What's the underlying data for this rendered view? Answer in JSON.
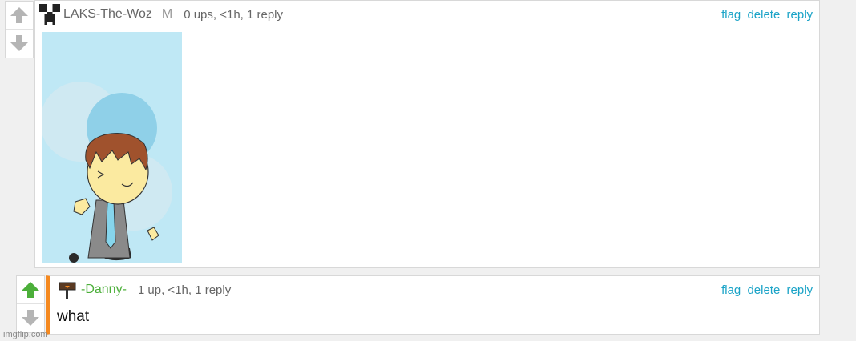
{
  "comments": [
    {
      "username": "LAKS-The-Woz",
      "badge": "M",
      "meta": "0 ups, <1h, 1 reply",
      "actions": {
        "flag": "flag",
        "delete": "delete",
        "reply": "reply"
      },
      "upvoted": false
    },
    {
      "username": "-Danny-",
      "meta": "1 up, <1h, 1 reply",
      "text": "what",
      "actions": {
        "flag": "flag",
        "delete": "delete",
        "reply": "reply"
      },
      "upvoted": true
    }
  ],
  "colors": {
    "link": "#1aa3c7",
    "upvote_active": "#4caf3a",
    "arrow_inactive": "#b5b5b5",
    "reply_bar": "#f5891f",
    "username_green": "#4caf3a"
  },
  "watermark": "imgflip.com"
}
